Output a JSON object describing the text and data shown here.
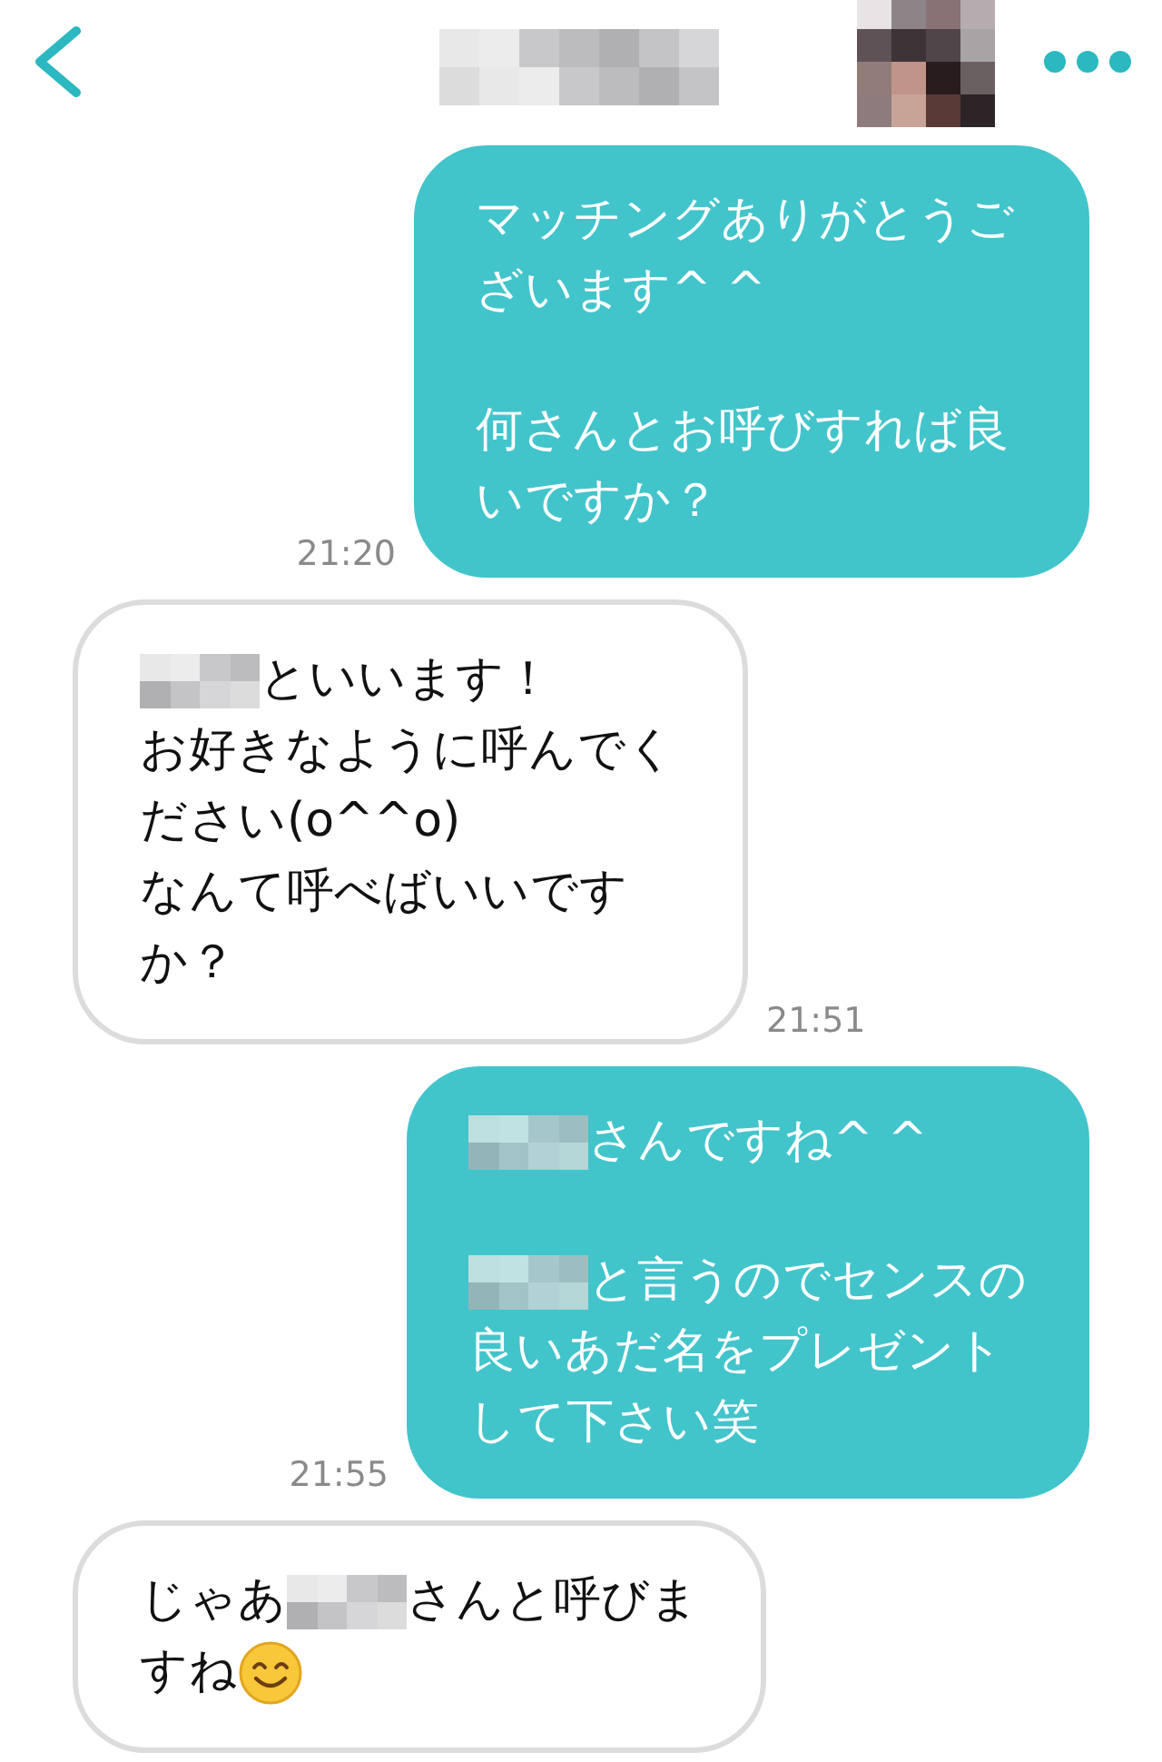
{
  "header": {
    "title": {
      "kind": "redacted"
    }
  },
  "messages": [
    {
      "kind": "sent",
      "time": "21:20",
      "paragraphs": [
        {
          "lines": [
            [
              {
                "kind": "text",
                "text": "マッチングありがとうご"
              }
            ],
            [
              {
                "kind": "text",
                "text": "ざいます^ ^"
              }
            ]
          ]
        },
        {
          "lines": [
            [
              {
                "kind": "text",
                "text": "何さんとお呼びすれば良"
              }
            ],
            [
              {
                "kind": "text",
                "text": "いですか？"
              }
            ]
          ]
        }
      ]
    },
    {
      "kind": "received",
      "time": "21:51",
      "paragraphs": [
        {
          "lines": [
            [
              {
                "kind": "redacted"
              },
              {
                "kind": "text",
                "text": "といいます！"
              }
            ],
            [
              {
                "kind": "text",
                "text": "お好きなように呼んでく"
              }
            ],
            [
              {
                "kind": "text",
                "text": "ださい(o^^o)"
              }
            ],
            [
              {
                "kind": "text",
                "text": "なんて呼べばいいです"
              }
            ],
            [
              {
                "kind": "text",
                "text": "か？"
              }
            ]
          ]
        }
      ]
    },
    {
      "kind": "sent",
      "time": "21:55",
      "paragraphs": [
        {
          "lines": [
            [
              {
                "kind": "redacted"
              },
              {
                "kind": "text",
                "text": "さんですね^ ^"
              }
            ]
          ]
        },
        {
          "lines": [
            [
              {
                "kind": "redacted"
              },
              {
                "kind": "text",
                "text": "と言うのでセンスの"
              }
            ],
            [
              {
                "kind": "text",
                "text": "良いあだ名をプレゼント"
              }
            ],
            [
              {
                "kind": "text",
                "text": "して下さい笑"
              }
            ]
          ]
        }
      ]
    },
    {
      "kind": "received",
      "paragraphs": [
        {
          "lines": [
            [
              {
                "kind": "text",
                "text": "じゃあ"
              },
              {
                "kind": "redacted"
              },
              {
                "kind": "text",
                "text": "さんと呼びま"
              }
            ],
            [
              {
                "kind": "text",
                "text": "すね"
              },
              {
                "kind": "emoji"
              }
            ]
          ]
        }
      ]
    }
  ]
}
